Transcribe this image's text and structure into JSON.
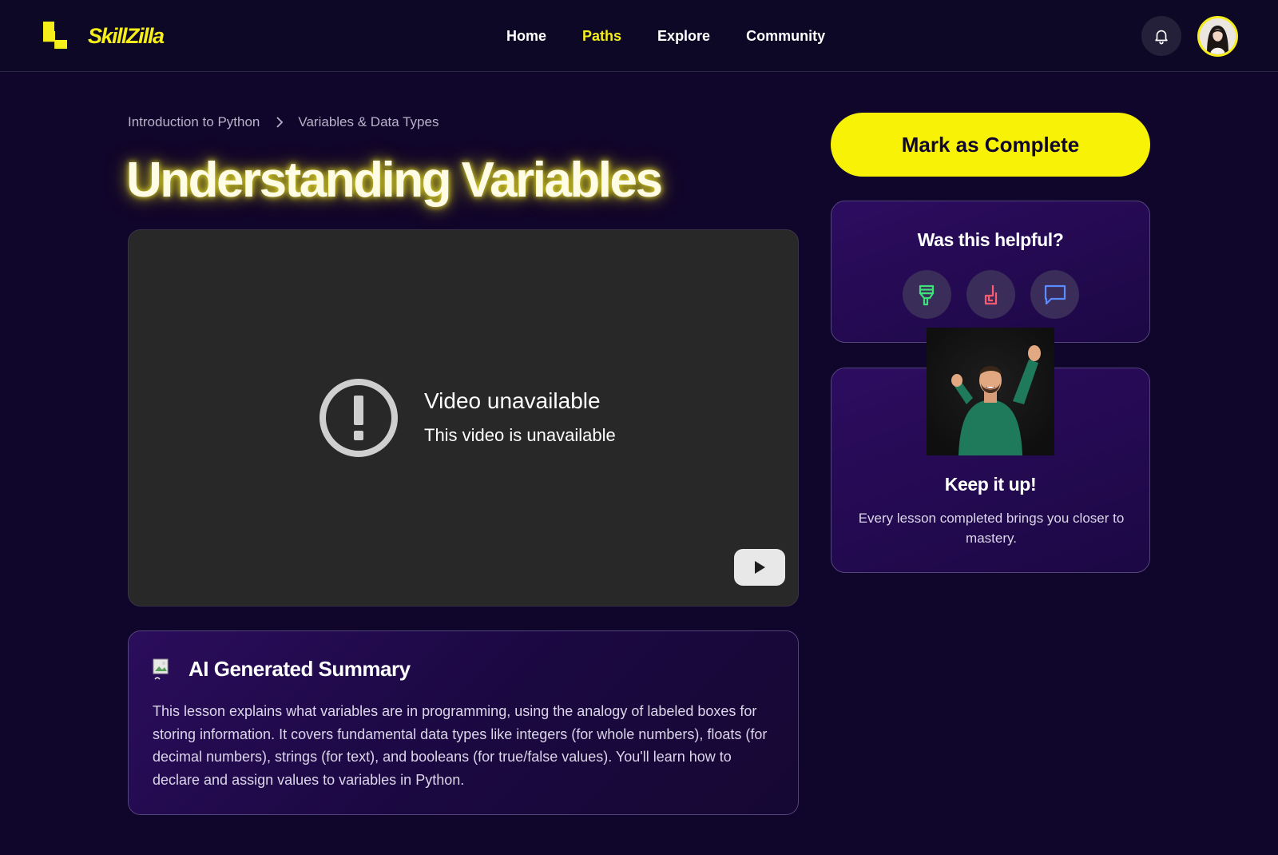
{
  "brand": {
    "name": "SkillZilla",
    "color": "#f5ee1a"
  },
  "nav": [
    {
      "label": "Home",
      "active": false
    },
    {
      "label": "Paths",
      "active": true
    },
    {
      "label": "Explore",
      "active": false
    },
    {
      "label": "Community",
      "active": false
    }
  ],
  "header": {
    "notifications_icon": "bell-icon",
    "avatar": "user-avatar"
  },
  "breadcrumb": {
    "parent": "Introduction to Python",
    "current": "Variables & Data Types"
  },
  "lesson": {
    "title": "Understanding Variables"
  },
  "video": {
    "status_title": "Video unavailable",
    "status_message": "This video is unavailable",
    "icons": [
      "alert-circle-icon",
      "youtube-play-icon"
    ]
  },
  "summary": {
    "title": "AI Generated Summary",
    "body": "This lesson explains what variables are in programming, using the analogy of labeled boxes for storing information. It covers fundamental data types like integers (for whole numbers), floats (for decimal numbers), strings (for text), and booleans (for true/false values). You'll learn how to declare and assign values to variables in Python."
  },
  "actions": {
    "mark_complete_label": "Mark as Complete"
  },
  "feedback": {
    "title": "Was this helpful?",
    "buttons": [
      {
        "icon": "thumbs-up-icon",
        "color": "#3ee07a"
      },
      {
        "icon": "thumbs-down-icon",
        "color": "#ff5a6e"
      },
      {
        "icon": "comment-icon",
        "color": "#5b8cff"
      }
    ]
  },
  "motivation": {
    "title": "Keep it up!",
    "body": "Every lesson completed brings you closer to mastery."
  },
  "colors": {
    "accent": "#f5ee1a",
    "background": "#10052a",
    "card": "#2d0c60"
  }
}
